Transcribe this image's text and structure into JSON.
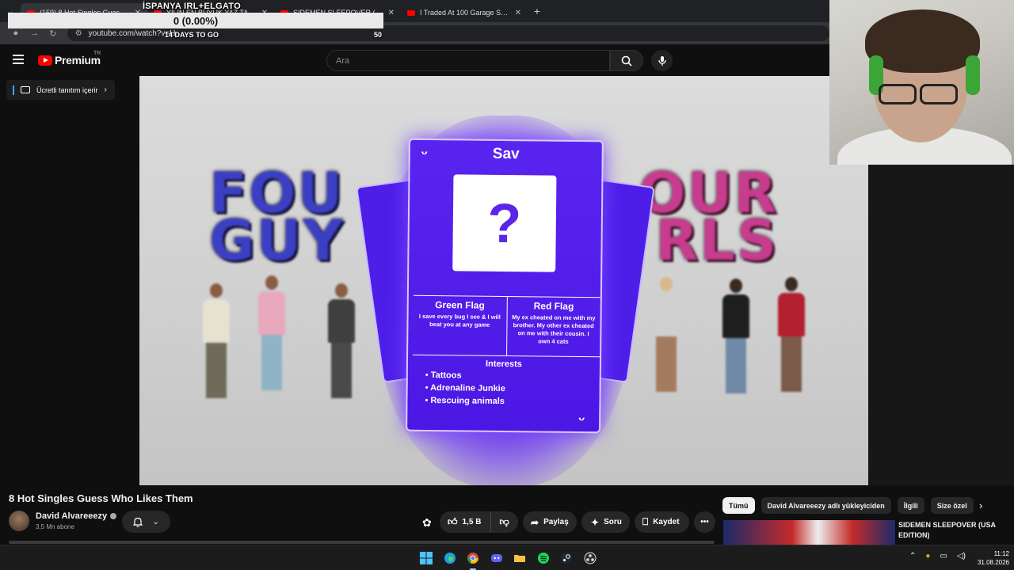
{
  "browser": {
    "tabs": [
      {
        "title": "(159) 8 Hot Singles Guess Who...",
        "active": true
      },
      {
        "title": "YILIN EN BÜYÜK YAZ TATİLİ",
        "active": false
      },
      {
        "title": "SIDEMEN SLEEPOVER (USA EDI...",
        "active": false
      },
      {
        "title": "I Traded At 100 Garage Sales, H...",
        "active": false
      }
    ],
    "new_tab": "+",
    "url": "youtube.com/watch?v=H"
  },
  "overlay": {
    "title": "İSPANYA IRL+ELGATO",
    "counter": "0 (0.00%)",
    "days": "14 DAYS TO GO",
    "goal": "50"
  },
  "masthead": {
    "logo": "Premium",
    "country": "TR",
    "search_placeholder": "Ara"
  },
  "promo": {
    "label": "Ücretli tanıtım içerir"
  },
  "video_content": {
    "left_heading": [
      "FOU",
      "GUY"
    ],
    "right_heading": [
      "OUR",
      "RLS"
    ],
    "card": {
      "name": "Sav",
      "image": "?",
      "green_flag_title": "Green Flag",
      "green_flag_text": "I save every bug I see & I will beat you at any game",
      "red_flag_title": "Red Flag",
      "red_flag_text": "My ex cheated on me with my brother. My other ex cheated on me with their cousin. I own 4 cats",
      "interests_title": "Interests",
      "interests": [
        "Tattoos",
        "Adrenaline Junkie",
        "Rescuing animals"
      ],
      "logo_mark": "ᴗ"
    }
  },
  "video": {
    "title": "8 Hot Singles Guess Who Likes Them",
    "channel": "David Alvareeezy",
    "subscribers": "3,5 Mn abone",
    "likes": "1,5 B",
    "share": "Paylaş",
    "ask": "Soru",
    "save": "Kaydet"
  },
  "chips": [
    "Tümü",
    "David Alvareeezy adlı yükleyiciden",
    "İlgili",
    "Size özel"
  ],
  "recommendation": {
    "title": "SIDEMEN SLEEPOVER (USA EDITION)"
  },
  "clock": {
    "time": "11:12",
    "date": "31.08.2026"
  },
  "colors": {
    "youtube_red": "#ff0000",
    "card_purple": "#4c17e4",
    "accent_blue": "#3ea6ff"
  }
}
